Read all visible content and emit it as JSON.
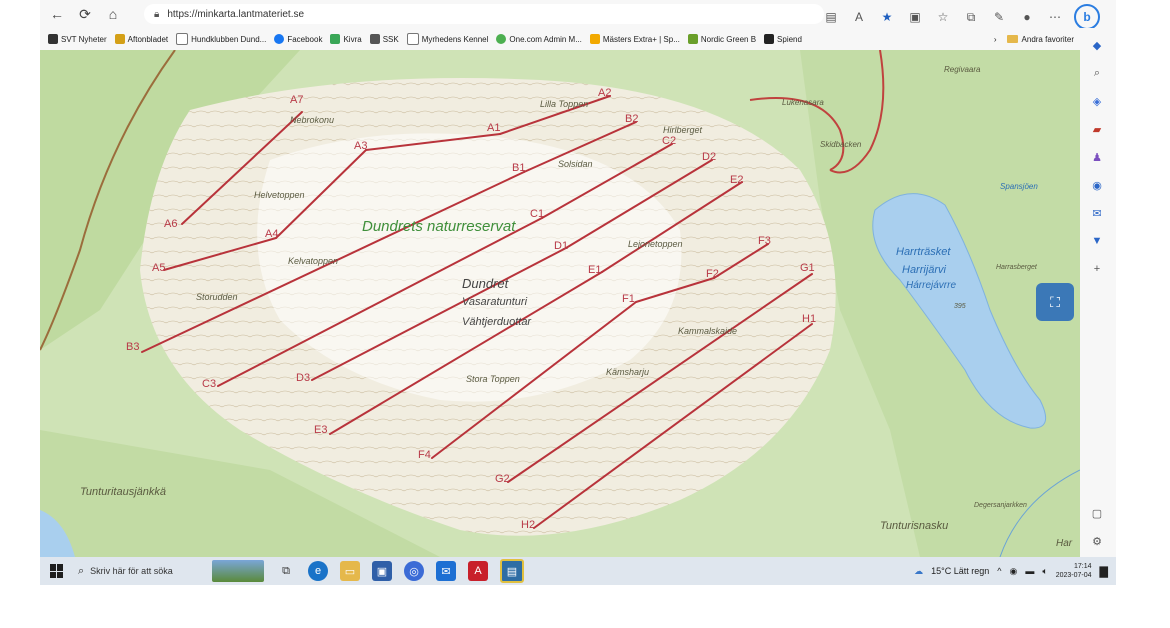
{
  "browser": {
    "url": "https://minkarta.lantmateriet.se",
    "bookmarks": [
      {
        "label": "SVT Nyheter",
        "icon_color": "#333333"
      },
      {
        "label": "Aftonbladet",
        "icon_color": "#d4a017"
      },
      {
        "label": "Hundklubben Dund...",
        "icon_color": "#777777"
      },
      {
        "label": "Facebook",
        "icon_color": "#1877f2"
      },
      {
        "label": "Kivra",
        "icon_color": "#3aa757"
      },
      {
        "label": "SSK",
        "icon_color": "#555555"
      },
      {
        "label": "Myrhedens Kennel",
        "icon_color": "#777777"
      },
      {
        "label": "One.com Admin M...",
        "icon_color": "#4caf50"
      },
      {
        "label": "Mästers Extra+ | Sp...",
        "icon_color": "#f2a900"
      },
      {
        "label": "Nordic Green B",
        "icon_color": "#6a9f2a"
      },
      {
        "label": "Spiend",
        "icon_color": "#222222"
      }
    ],
    "other_favorites": "Andra favoriter"
  },
  "map": {
    "place_names": {
      "reserve": "Dundrets naturreservat",
      "mountain1": "Dundret",
      "mountain2": "Vasaratunturi",
      "mountain3": "Vähtjerduottar",
      "lake1": "Harrträsket",
      "lake2": "Harrijärvi",
      "lake3": "Hárrejávrre",
      "lille_toppen": "Lilla Toppen",
      "hirlberget": "Hirlberget",
      "solsidan": "Solsidan",
      "helvetoppen": "Helvetoppen",
      "nebrokonu": "Nebrokonu",
      "kelvatoppen": "Kelvatoppen",
      "storudden": "Storudden",
      "lejonetoppen": "Lejonetoppen",
      "kammalskaide": "Kammalskaide",
      "kamsharju": "Kämsharju",
      "stora_toppen": "Stora Toppen",
      "tunturitausjankka": "Tunturitausjänkkä",
      "tunturisnasku": "Tunturisnasku",
      "degersanjarkken": "Degersanjarkken",
      "har": "Har",
      "harrasberget": "Harrasberget",
      "spansjoen": "Spansjöen",
      "skidbacken": "Skidbacken",
      "lukenasara": "Lukenasara",
      "reguvaara": "Regivaara",
      "lake_num": "395"
    },
    "lines": [
      {
        "from": "A7",
        "to": "A6"
      },
      {
        "from": "A3",
        "to": "A4"
      },
      {
        "from": "A4",
        "to": "A5"
      },
      {
        "from": "A3",
        "to": "A1"
      },
      {
        "from": "A1",
        "to": "A2"
      },
      {
        "from": "B2",
        "to": "B1"
      },
      {
        "from": "B1",
        "to": "B3"
      },
      {
        "from": "C2",
        "to": "C1"
      },
      {
        "from": "C1",
        "to": "C3"
      },
      {
        "from": "D2",
        "to": "D1"
      },
      {
        "from": "D1",
        "to": "D3"
      },
      {
        "from": "E2",
        "to": "E1"
      },
      {
        "from": "E1",
        "to": "E3"
      },
      {
        "from": "F3",
        "to": "F2"
      },
      {
        "from": "F2",
        "to": "F1"
      },
      {
        "from": "F1",
        "to": "F4"
      },
      {
        "from": "G1",
        "to": "G2"
      },
      {
        "from": "H1",
        "to": "H2"
      }
    ],
    "point_labels": [
      "A7",
      "A6",
      "A3",
      "A4",
      "A5",
      "A1",
      "A2",
      "B2",
      "B1",
      "B3",
      "C2",
      "C1",
      "C3",
      "D2",
      "D1",
      "D3",
      "E2",
      "E1",
      "E3",
      "F3",
      "F2",
      "F1",
      "F4",
      "G1",
      "G2",
      "H1",
      "H2"
    ]
  },
  "taskbar": {
    "search_placeholder": "Skriv här för att söka",
    "weather": "15°C Lätt regn",
    "time": "17:14",
    "date": "2023-07-04"
  },
  "colors": {
    "line_color": "#b8333b",
    "map_green": "#cfe3b6",
    "lake_blue": "#a9cfee",
    "accent_blue": "#3b78b7"
  }
}
